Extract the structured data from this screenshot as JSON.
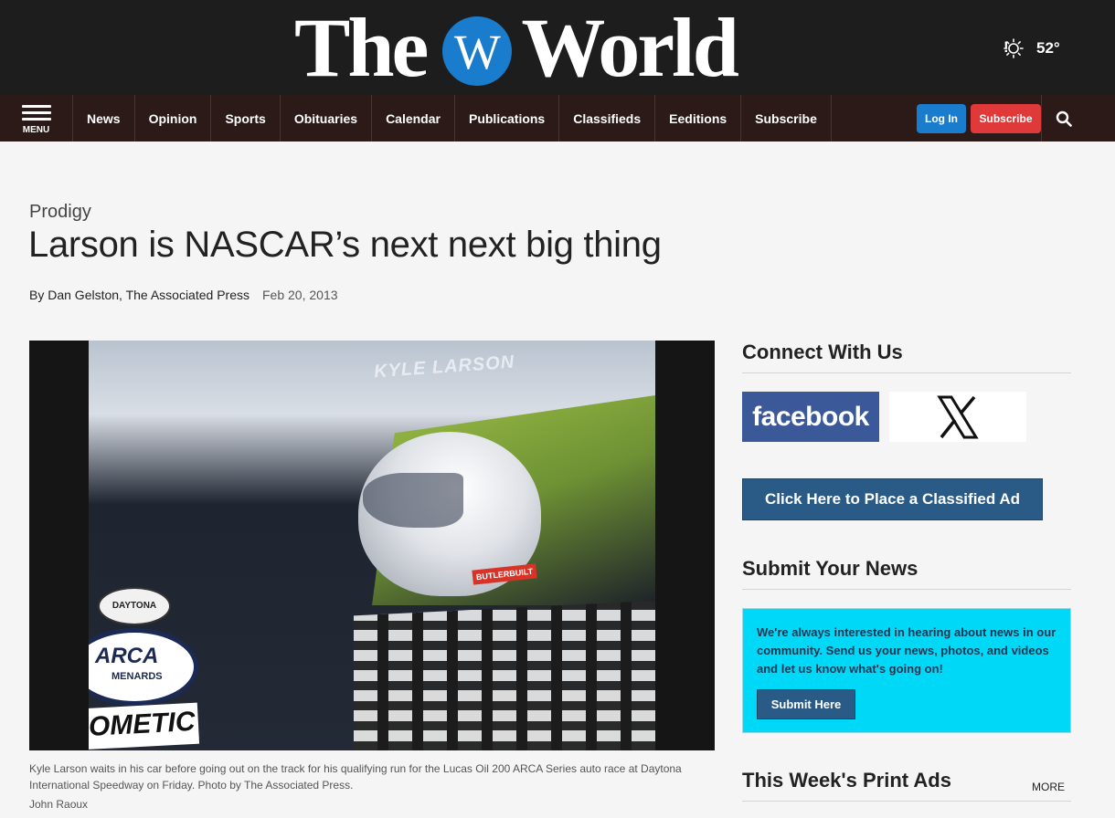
{
  "masthead": {
    "logo_the": "The",
    "logo_w": "W",
    "logo_world": "World",
    "weather_icon": "sun-icon",
    "alert_icon": "alert-icon",
    "alert_symbol": "!",
    "temperature": "52°"
  },
  "nav": {
    "menu_label": "MENU",
    "items": [
      "News",
      "Opinion",
      "Sports",
      "Obituaries",
      "Calendar",
      "Publications",
      "Classifieds",
      "Eeditions",
      "Subscribe"
    ],
    "login_label": "Log In",
    "subscribe_label": "Subscribe",
    "search_icon": "search-icon"
  },
  "article": {
    "kicker": "Prodigy",
    "headline": "Larson is NASCAR’s next next big thing",
    "byline": "By Dan Gelston, The Associated Press",
    "date": "Feb 20, 2013",
    "photo_text": {
      "car_name": "KYLE LARSON",
      "daytona": "DAYTONA",
      "arca": "ARCA",
      "menards": "MENARDS",
      "dometic": "OMETIC",
      "butlerbuilt": "BUTLERBUILT"
    },
    "caption": "Kyle Larson waits in his car before going out on the track for his qualifying run for the Lucas Oil 200 ARCA Series auto race at Daytona International Speedway on Friday. Photo by The Associated Press.",
    "credit": "John Raoux"
  },
  "sidebar": {
    "connect_heading": "Connect With Us",
    "facebook_label": "facebook",
    "x_label": "X",
    "classified_label": "Click Here to Place a Classified Ad",
    "submit_heading": "Submit Your News",
    "submit_text": "We're always interested in hearing about news in our community. Send us your news, photos, and videos and let us know what's going on!",
    "submit_button": "Submit Here",
    "print_ads_heading": "This Week's Print Ads",
    "more_label": "MORE"
  },
  "colors": {
    "masthead_bg": "#1d1d1d",
    "nav_bg": "#2b1a18",
    "login_blue": "#1a7ccc",
    "subscribe_red": "#e0393a",
    "facebook_blue": "#3b5998",
    "classified_blue": "#2a5b86",
    "submit_box_cyan": "#00d8f8"
  }
}
